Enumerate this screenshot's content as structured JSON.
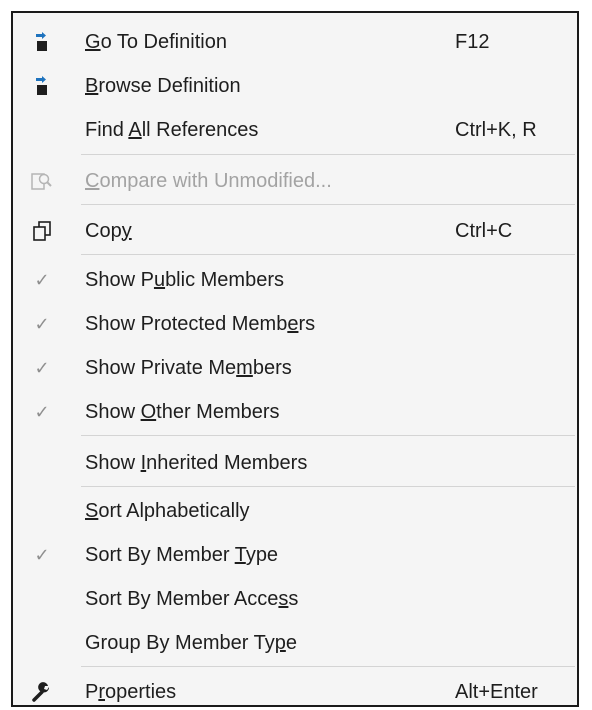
{
  "menu": {
    "items": [
      {
        "label": "Go To Definition",
        "ul": 0,
        "shortcut": "F12",
        "icon": "go-to-definition-icon",
        "enabled": true
      },
      {
        "label": "Browse Definition",
        "ul": 0,
        "shortcut": "",
        "icon": "browse-definition-icon",
        "enabled": true
      },
      {
        "label": "Find All References",
        "ul": 5,
        "shortcut": "Ctrl+K, R",
        "icon": "",
        "enabled": true
      },
      {
        "label": "Compare with Unmodified...",
        "ul": 0,
        "shortcut": "",
        "icon": "compare-icon",
        "enabled": false
      },
      {
        "label": "Copy",
        "ul": 3,
        "shortcut": "Ctrl+C",
        "icon": "copy-icon",
        "enabled": true
      },
      {
        "label": "Show Public Members",
        "ul": 6,
        "shortcut": "",
        "icon": "checkmark-icon",
        "checked": true,
        "enabled": true
      },
      {
        "label": "Show Protected Members",
        "ul": 19,
        "shortcut": "",
        "icon": "checkmark-icon",
        "checked": true,
        "enabled": true
      },
      {
        "label": "Show Private Members",
        "ul": 15,
        "shortcut": "",
        "icon": "checkmark-icon",
        "checked": true,
        "enabled": true
      },
      {
        "label": "Show Other Members",
        "ul": 5,
        "shortcut": "",
        "icon": "checkmark-icon",
        "checked": true,
        "enabled": true
      },
      {
        "label": "Show Inherited Members",
        "ul": 5,
        "shortcut": "",
        "icon": "",
        "enabled": true
      },
      {
        "label": "Sort Alphabetically",
        "ul": 0,
        "shortcut": "",
        "icon": "",
        "enabled": true
      },
      {
        "label": "Sort By Member Type",
        "ul": 15,
        "shortcut": "",
        "icon": "checkmark-icon",
        "checked": true,
        "enabled": true
      },
      {
        "label": "Sort By Member Access",
        "ul": 19,
        "shortcut": "",
        "icon": "",
        "enabled": true
      },
      {
        "label": "Group By Member Type",
        "ul": 18,
        "shortcut": "",
        "icon": "",
        "enabled": true
      },
      {
        "label": "Properties",
        "ul": 1,
        "shortcut": "Alt+Enter",
        "icon": "wrench-icon",
        "enabled": true
      }
    ]
  },
  "colors": {
    "background": "#f5f5f5",
    "text": "#1e1e1e",
    "disabled_text": "#a3a3a3",
    "separator": "#d4d4d4",
    "arrow_blue": "#1e73be",
    "check": "#8f8f8f"
  }
}
